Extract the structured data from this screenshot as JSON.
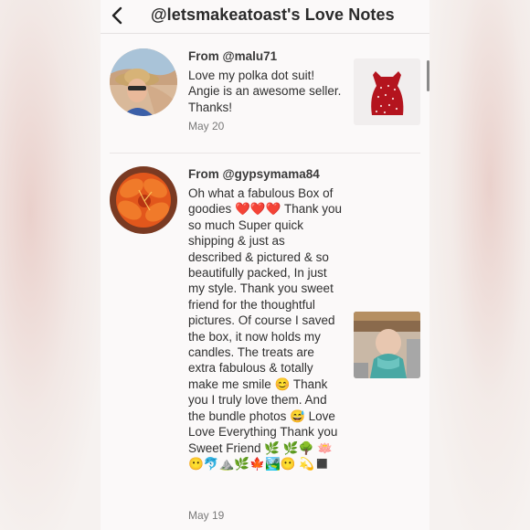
{
  "header": {
    "title": "@letsmakeatoast's Love Notes",
    "back_icon": "chevron-left-icon"
  },
  "notes": [
    {
      "from": "From @malu71",
      "message": "Love my polka dot suit! Angie is an awesome seller. Thanks!",
      "date": "May 20"
    },
    {
      "from": "From @gypsymama84",
      "message": "Oh what a fabulous Box of goodies ❤️❤️❤️ Thank you so much Super quick shipping & just as described & pictured & so beautifully packed, In just my style. Thank you sweet friend for the thoughtful pictures. Of course I saved the box, it now holds my candles. The treats are extra fabulous & totally make me smile 😊 Thank you I truly love them. And the bundle photos 😅 Love Love Everything Thank you Sweet Friend 🌿 🌿🌳 🪷😶🐬⛰️🌿🍁🏞️😶 💫◼️",
      "date": "May 19"
    }
  ],
  "colors": {
    "accent": "#b4141e",
    "text": "#2f2f2f",
    "muted": "#7a7a7a",
    "divider": "#e9e6e6"
  }
}
